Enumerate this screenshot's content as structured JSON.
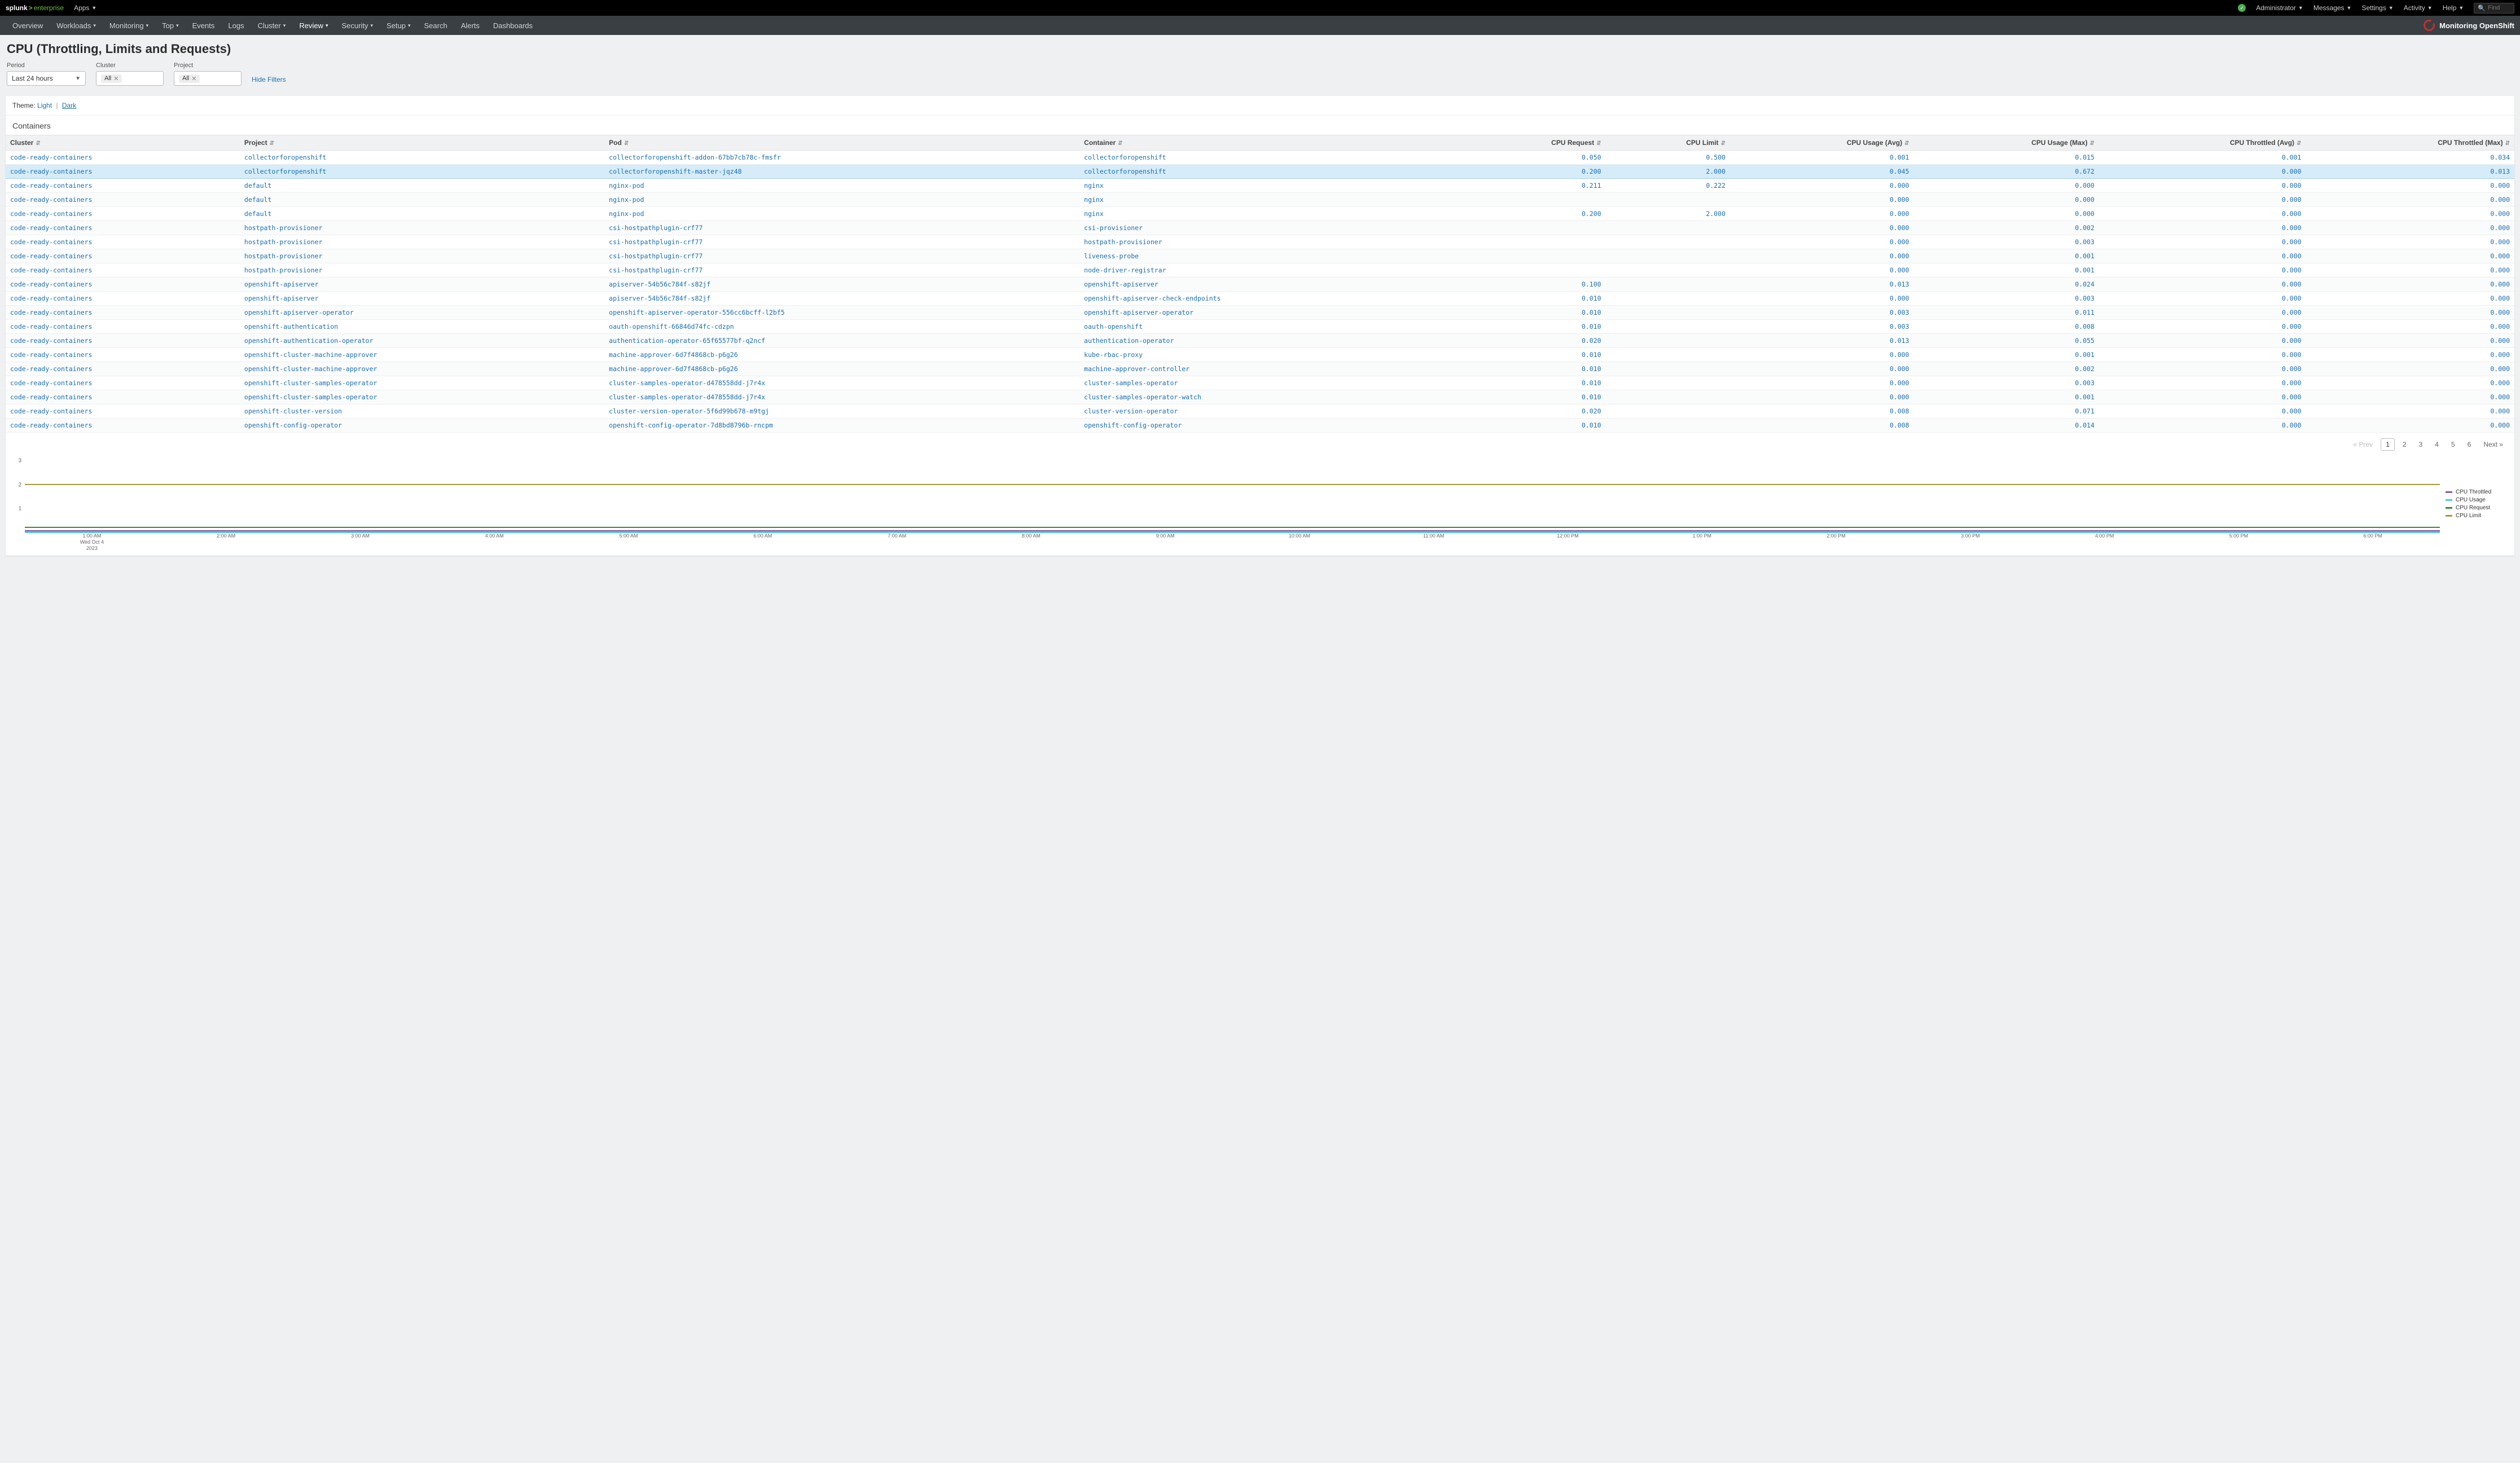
{
  "topbar": {
    "brand_bold": "splunk",
    "brand_ent": "enterprise",
    "apps": "Apps",
    "right": [
      "Administrator",
      "Messages",
      "Settings",
      "Activity",
      "Help"
    ],
    "find_placeholder": "Find"
  },
  "nav": {
    "items": [
      "Overview",
      "Workloads",
      "Monitoring",
      "Top",
      "Events",
      "Logs",
      "Cluster",
      "Review",
      "Security",
      "Setup",
      "Search",
      "Alerts",
      "Dashboards"
    ],
    "dropdowns": [
      false,
      true,
      true,
      true,
      false,
      false,
      true,
      true,
      true,
      true,
      false,
      false,
      false
    ],
    "active_index": 7,
    "app_title": "Monitoring OpenShift"
  },
  "page": {
    "title": "CPU (Throttling, Limits and Requests)",
    "filters": {
      "period_label": "Period",
      "period_value": "Last 24 hours",
      "cluster_label": "Cluster",
      "cluster_chip": "All",
      "project_label": "Project",
      "project_chip": "All",
      "hide": "Hide Filters"
    },
    "theme": {
      "prefix": "Theme:",
      "light": "Light",
      "dark": "Dark"
    },
    "section": "Containers"
  },
  "table": {
    "columns": [
      "Cluster",
      "Project",
      "Pod",
      "Container",
      "CPU Request",
      "CPU Limit",
      "CPU Usage (Avg)",
      "CPU Usage (Max)",
      "CPU Throttled (Avg)",
      "CPU Throttled (Max)"
    ],
    "selected_row": 1,
    "rows": [
      [
        "code-ready-containers",
        "collectorforopenshift",
        "collectorforopenshift-addon-67bb7cb78c-fmsfr",
        "collectorforopenshift",
        "0.050",
        "0.500",
        "0.001",
        "0.015",
        "0.001",
        "0.034"
      ],
      [
        "code-ready-containers",
        "collectorforopenshift",
        "collectorforopenshift-master-jqz48",
        "collectorforopenshift",
        "0.200",
        "2.000",
        "0.045",
        "0.672",
        "0.000",
        "0.013"
      ],
      [
        "code-ready-containers",
        "default",
        "nginx-pod",
        "nginx",
        "0.211",
        "0.222",
        "0.000",
        "0.000",
        "0.000",
        "0.000"
      ],
      [
        "code-ready-containers",
        "default",
        "nginx-pod",
        "nginx",
        "",
        "",
        "0.000",
        "0.000",
        "0.000",
        "0.000"
      ],
      [
        "code-ready-containers",
        "default",
        "nginx-pod",
        "nginx",
        "0.200",
        "2.000",
        "0.000",
        "0.000",
        "0.000",
        "0.000"
      ],
      [
        "code-ready-containers",
        "hostpath-provisioner",
        "csi-hostpathplugin-crf77",
        "csi-provisioner",
        "",
        "",
        "0.000",
        "0.002",
        "0.000",
        "0.000"
      ],
      [
        "code-ready-containers",
        "hostpath-provisioner",
        "csi-hostpathplugin-crf77",
        "hostpath-provisioner",
        "",
        "",
        "0.000",
        "0.003",
        "0.000",
        "0.000"
      ],
      [
        "code-ready-containers",
        "hostpath-provisioner",
        "csi-hostpathplugin-crf77",
        "liveness-probe",
        "",
        "",
        "0.000",
        "0.001",
        "0.000",
        "0.000"
      ],
      [
        "code-ready-containers",
        "hostpath-provisioner",
        "csi-hostpathplugin-crf77",
        "node-driver-registrar",
        "",
        "",
        "0.000",
        "0.001",
        "0.000",
        "0.000"
      ],
      [
        "code-ready-containers",
        "openshift-apiserver",
        "apiserver-54b56c784f-s82jf",
        "openshift-apiserver",
        "0.100",
        "",
        "0.013",
        "0.024",
        "0.000",
        "0.000"
      ],
      [
        "code-ready-containers",
        "openshift-apiserver",
        "apiserver-54b56c784f-s82jf",
        "openshift-apiserver-check-endpoints",
        "0.010",
        "",
        "0.000",
        "0.003",
        "0.000",
        "0.000"
      ],
      [
        "code-ready-containers",
        "openshift-apiserver-operator",
        "openshift-apiserver-operator-556cc6bcff-l2bf5",
        "openshift-apiserver-operator",
        "0.010",
        "",
        "0.003",
        "0.011",
        "0.000",
        "0.000"
      ],
      [
        "code-ready-containers",
        "openshift-authentication",
        "oauth-openshift-66846d74fc-cdzpn",
        "oauth-openshift",
        "0.010",
        "",
        "0.003",
        "0.008",
        "0.000",
        "0.000"
      ],
      [
        "code-ready-containers",
        "openshift-authentication-operator",
        "authentication-operator-65f65577bf-q2ncf",
        "authentication-operator",
        "0.020",
        "",
        "0.013",
        "0.055",
        "0.000",
        "0.000"
      ],
      [
        "code-ready-containers",
        "openshift-cluster-machine-approver",
        "machine-approver-6d7f4868cb-p6g26",
        "kube-rbac-proxy",
        "0.010",
        "",
        "0.000",
        "0.001",
        "0.000",
        "0.000"
      ],
      [
        "code-ready-containers",
        "openshift-cluster-machine-approver",
        "machine-approver-6d7f4868cb-p6g26",
        "machine-approver-controller",
        "0.010",
        "",
        "0.000",
        "0.002",
        "0.000",
        "0.000"
      ],
      [
        "code-ready-containers",
        "openshift-cluster-samples-operator",
        "cluster-samples-operator-d478558dd-j7r4x",
        "cluster-samples-operator",
        "0.010",
        "",
        "0.000",
        "0.003",
        "0.000",
        "0.000"
      ],
      [
        "code-ready-containers",
        "openshift-cluster-samples-operator",
        "cluster-samples-operator-d478558dd-j7r4x",
        "cluster-samples-operator-watch",
        "0.010",
        "",
        "0.000",
        "0.001",
        "0.000",
        "0.000"
      ],
      [
        "code-ready-containers",
        "openshift-cluster-version",
        "cluster-version-operator-5f6d99b678-m9tgj",
        "cluster-version-operator",
        "0.020",
        "",
        "0.008",
        "0.071",
        "0.000",
        "0.000"
      ],
      [
        "code-ready-containers",
        "openshift-config-operator",
        "openshift-config-operator-7d8bd8796b-rncpm",
        "openshift-config-operator",
        "0.010",
        "",
        "0.008",
        "0.014",
        "0.000",
        "0.000"
      ]
    ]
  },
  "pager": {
    "prev": "« Prev",
    "pages": [
      "1",
      "2",
      "3",
      "4",
      "5",
      "6"
    ],
    "next": "Next »",
    "current": 0
  },
  "chart_data": {
    "type": "line",
    "title": "",
    "xlabel": "",
    "ylabel": "",
    "ylim": [
      0,
      3
    ],
    "yticks": [
      1,
      2,
      3
    ],
    "x_times": [
      "1:00 AM",
      "2:00 AM",
      "3:00 AM",
      "4:00 AM",
      "5:00 AM",
      "6:00 AM",
      "7:00 AM",
      "8:00 AM",
      "9:00 AM",
      "10:00 AM",
      "11:00 AM",
      "12:00 PM",
      "1:00 PM",
      "2:00 PM",
      "3:00 PM",
      "4:00 PM",
      "5:00 PM",
      "6:00 PM"
    ],
    "x_sub": [
      "Wed Oct 4",
      "2023"
    ],
    "series": [
      {
        "name": "CPU Throttled",
        "constant": 0.0,
        "color": "#8a5aa8"
      },
      {
        "name": "CPU Usage",
        "constant": 0.05,
        "color": "#4cc8e0"
      },
      {
        "name": "CPU Request",
        "constant": 0.2,
        "color": "#3a8a3a"
      },
      {
        "name": "CPU Limit",
        "constant": 2.0,
        "color": "#a9983a"
      }
    ],
    "legend": [
      "CPU Throttled",
      "CPU Usage",
      "CPU Request",
      "CPU Limit"
    ]
  }
}
